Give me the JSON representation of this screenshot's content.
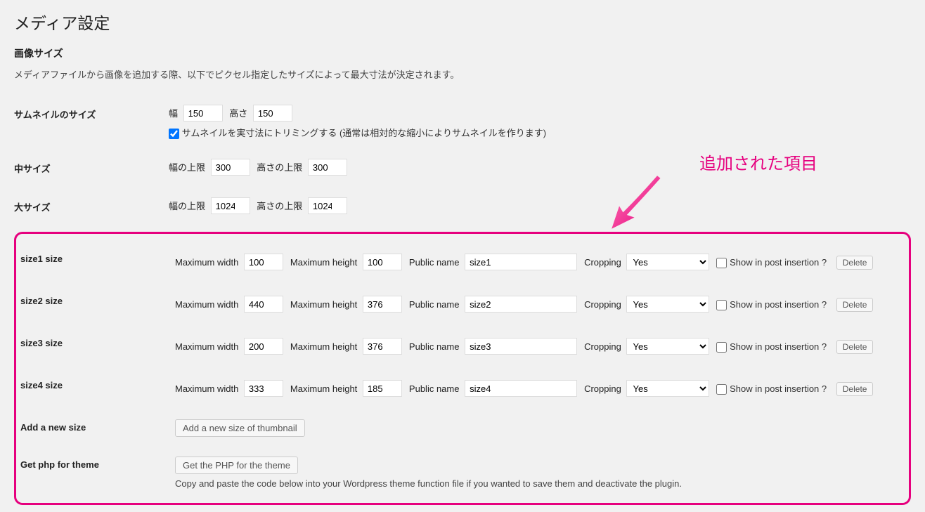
{
  "page": {
    "title": "メディア設定",
    "section_title": "画像サイズ",
    "description": "メディアファイルから画像を追加する際、以下でピクセル指定したサイズによって最大寸法が決定されます。"
  },
  "thumbnail": {
    "label": "サムネイルのサイズ",
    "width_label": "幅",
    "width_value": "150",
    "height_label": "高さ",
    "height_value": "150",
    "crop_checked": true,
    "crop_label": "サムネイルを実寸法にトリミングする (通常は相対的な縮小によりサムネイルを作ります)"
  },
  "medium": {
    "label": "中サイズ",
    "width_label": "幅の上限",
    "width_value": "300",
    "height_label": "高さの上限",
    "height_value": "300"
  },
  "large": {
    "label": "大サイズ",
    "width_label": "幅の上限",
    "width_value": "1024",
    "height_label": "高さの上限",
    "height_value": "1024"
  },
  "callout": "追加された項目",
  "common": {
    "max_width_label": "Maximum width",
    "max_height_label": "Maximum height",
    "public_name_label": "Public name",
    "cropping_label": "Cropping",
    "cropping_value": "Yes",
    "show_label": "Show in post insertion ?",
    "delete_label": "Delete"
  },
  "sizes": [
    {
      "row_label": "size1 size",
      "width": "100",
      "height": "100",
      "name": "size1"
    },
    {
      "row_label": "size2 size",
      "width": "440",
      "height": "376",
      "name": "size2"
    },
    {
      "row_label": "size3 size",
      "width": "200",
      "height": "376",
      "name": "size3"
    },
    {
      "row_label": "size4 size",
      "width": "333",
      "height": "185",
      "name": "size4"
    }
  ],
  "add_new": {
    "label": "Add a new size",
    "button": "Add a new size of thumbnail"
  },
  "get_php": {
    "label": "Get php for theme",
    "button": "Get the PHP for the theme",
    "note": "Copy and paste the code below into your Wordpress theme function file if you wanted to save them and deactivate the plugin."
  }
}
